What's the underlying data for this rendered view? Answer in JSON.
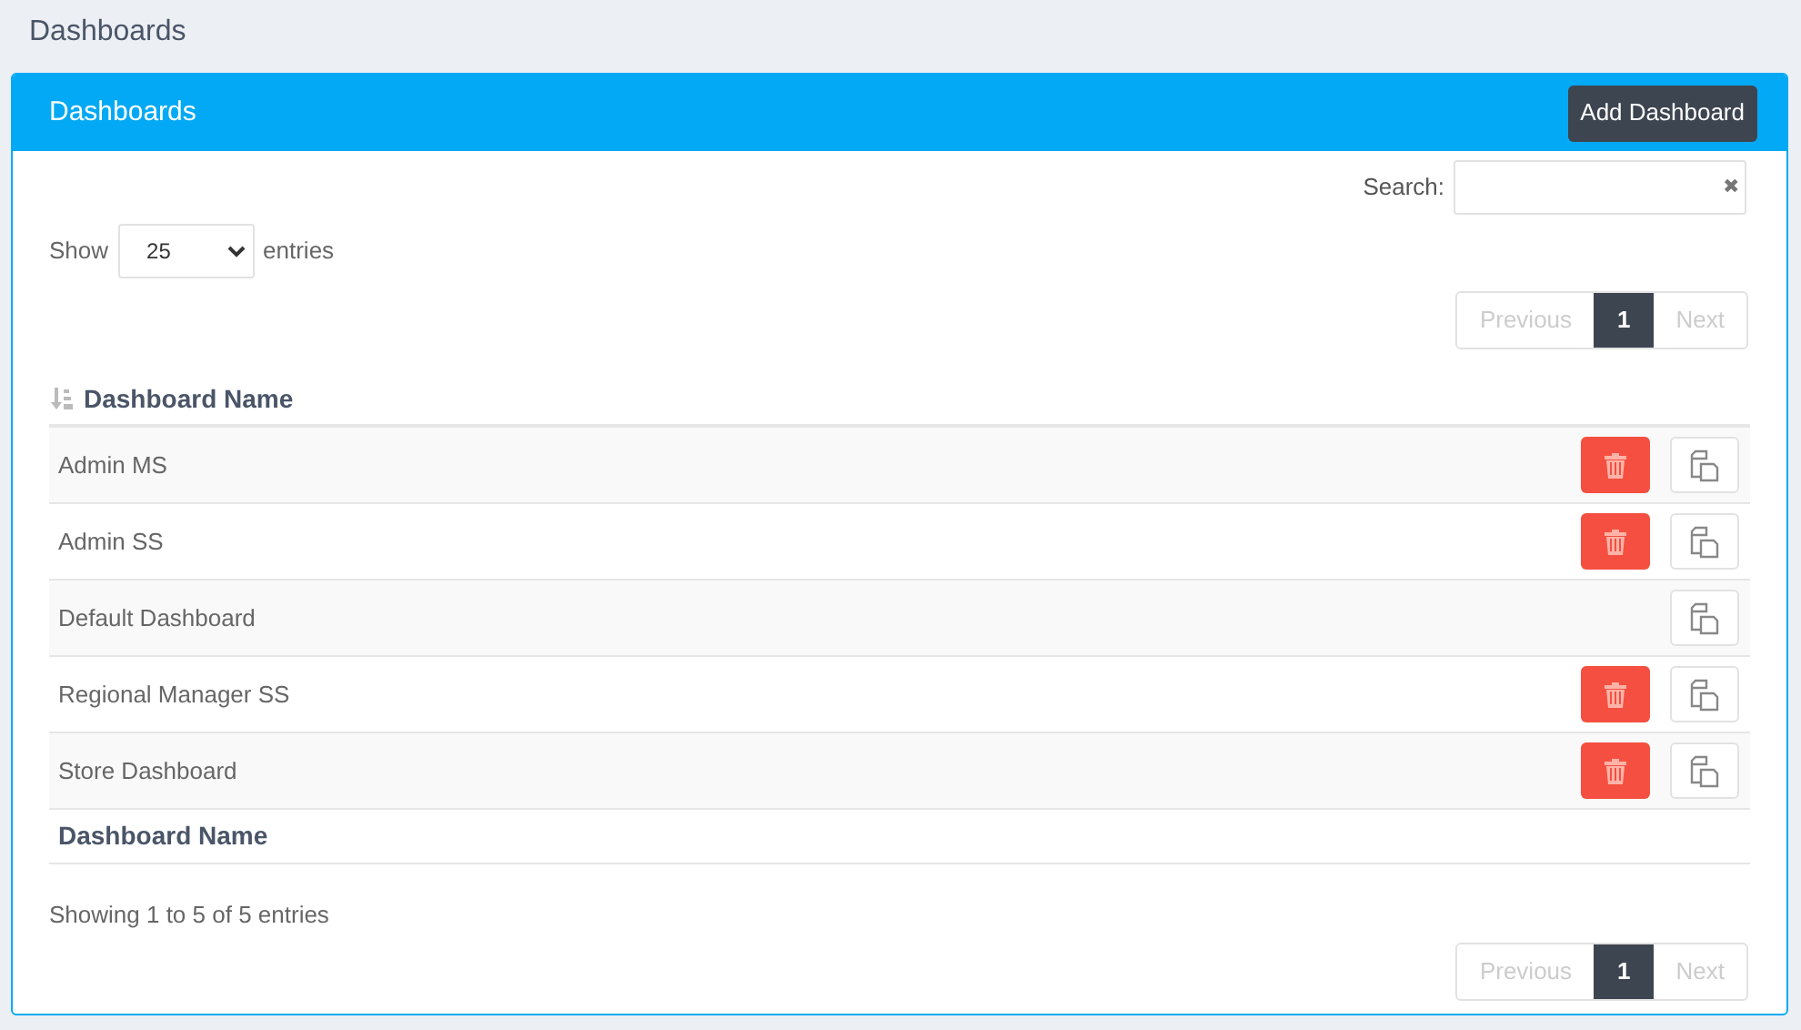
{
  "page_title": "Dashboards",
  "panel": {
    "title": "Dashboards",
    "add_button": "Add Dashboard"
  },
  "search": {
    "label": "Search:",
    "clear": "✖"
  },
  "length": {
    "before": "Show",
    "value": "25",
    "after": "entries"
  },
  "pagination_top": {
    "previous": {
      "label": "Previous",
      "disabled": true
    },
    "pages": [
      {
        "label": "1",
        "selected": true
      }
    ],
    "next": {
      "label": "Next",
      "disabled": true
    }
  },
  "table": {
    "column": "Dashboard Name",
    "rows": [
      {
        "name": "Admin MS",
        "deletable": true
      },
      {
        "name": "Admin SS",
        "deletable": true
      },
      {
        "name": "Default Dashboard",
        "deletable": false
      },
      {
        "name": "Regional Manager SS",
        "deletable": true
      },
      {
        "name": "Store Dashboard",
        "deletable": true
      }
    ],
    "footer_column": "Dashboard Name"
  },
  "info": "Showing 1 to 5 of 5 entries",
  "pagination_bottom": {
    "previous": {
      "label": "Previous",
      "disabled": true
    },
    "pages": [
      {
        "label": "1",
        "selected": true
      }
    ],
    "next": {
      "label": "Next",
      "disabled": true
    }
  }
}
